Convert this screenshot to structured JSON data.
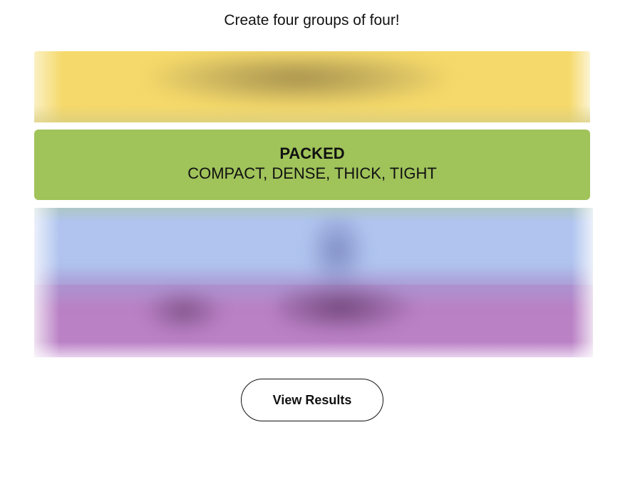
{
  "instructions": "Create four groups of four!",
  "groups": [
    {
      "state": "obscured",
      "color": "#f5d96a"
    },
    {
      "state": "solved",
      "color": "#a0c35a",
      "title": "PACKED",
      "members": "COMPACT, DENSE, THICK, TIGHT"
    },
    {
      "state": "obscured",
      "color": "#b0c4ef"
    },
    {
      "state": "obscured",
      "color": "#ba81c5"
    }
  ],
  "actions": {
    "view_results_label": "View Results"
  }
}
